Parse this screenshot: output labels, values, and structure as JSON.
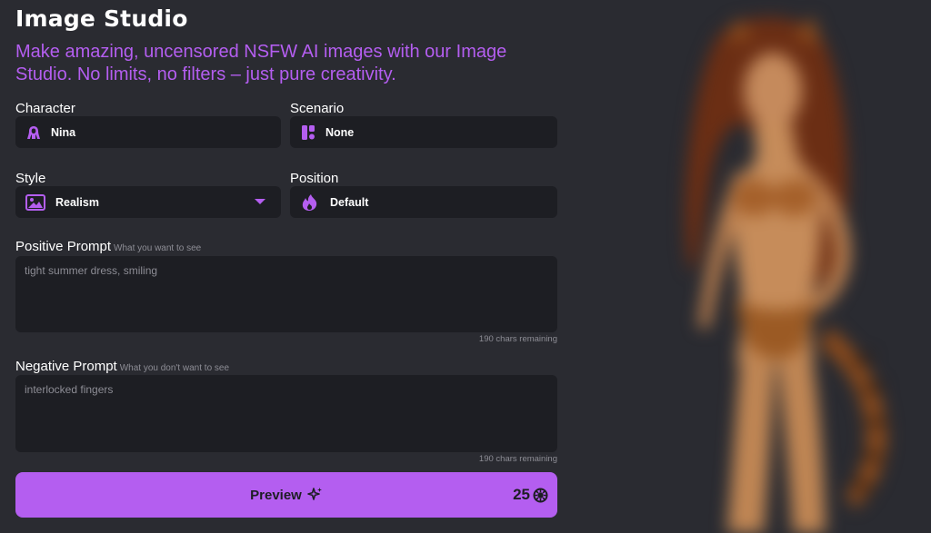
{
  "header": {
    "title": "Image Studio",
    "subtitle": "Make amazing, uncensored NSFW AI images with our Image Studio. No limits, no filters – just pure creativity."
  },
  "form": {
    "character": {
      "label": "Character",
      "value": "Nina",
      "icon": "woman-silhouette-icon"
    },
    "scenario": {
      "label": "Scenario",
      "value": "None",
      "icon": "layout-blocks-icon"
    },
    "style": {
      "label": "Style",
      "value": "Realism",
      "icon": "image-icon"
    },
    "position": {
      "label": "Position",
      "value": "Default",
      "icon": "flame-icon"
    },
    "positive_prompt": {
      "label": "Positive Prompt",
      "hint": "What you want to see",
      "placeholder": "tight summer dress, smiling",
      "remaining": "190 chars remaining"
    },
    "negative_prompt": {
      "label": "Negative Prompt",
      "hint": "What you don't want to see",
      "placeholder": "interlocked fingers",
      "remaining": "190 chars remaining"
    }
  },
  "preview_button": {
    "label": "Preview",
    "icon": "sparkle-icon",
    "cost": "25",
    "cost_icon": "coin-icon"
  },
  "colors": {
    "accent": "#b45ef0",
    "background": "#2a2b31",
    "field_background": "#1d1e23"
  }
}
